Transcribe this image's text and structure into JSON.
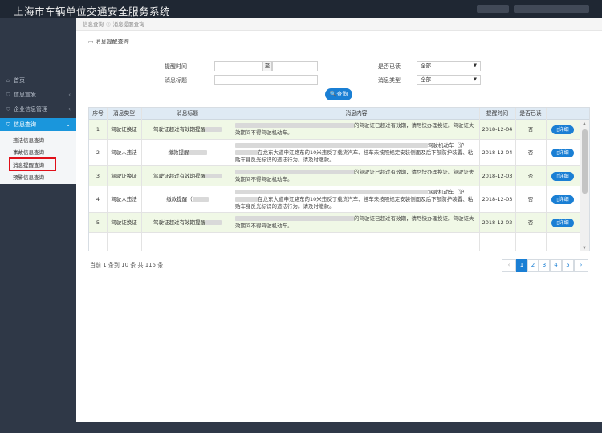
{
  "app": {
    "title": "上海市车辆单位交通安全服务系统"
  },
  "sidebar": {
    "items": [
      {
        "label": "首页",
        "icon": "home-icon"
      },
      {
        "label": "信息宣发",
        "icon": "shield-icon"
      },
      {
        "label": "企业信息管理",
        "icon": "shield-icon"
      },
      {
        "label": "信息查询",
        "icon": "shield-icon"
      }
    ],
    "sub_items": [
      "违法信息查询",
      "事故信息查询",
      "消息提醒查询",
      "预警信息查询"
    ]
  },
  "breadcrumb": [
    "信息查询",
    "消息提醒查询"
  ],
  "page": {
    "title": "消息提醒查询"
  },
  "filters": {
    "remind_time_label": "提醒时间",
    "to_label": "至",
    "title_label": "消息标题",
    "read_label": "是否已读",
    "read_value": "全部",
    "type_label": "消息类型",
    "type_value": "全部",
    "query_label": "查询"
  },
  "table": {
    "headers": [
      "序号",
      "消息类型",
      "消息标题",
      "消息内容",
      "提醒时间",
      "是否已读",
      ""
    ],
    "detail_label": "详细",
    "rows": [
      {
        "no": "1",
        "type": "驾驶证换证",
        "title": "驾驶证超过有效期提醒",
        "content": "的驾驶证已超过有效期，请尽快办理换证。驾驶证失效期间不得驾驶机动车。",
        "time": "2018-12-04",
        "read": "否"
      },
      {
        "no": "2",
        "type": "驾驶人违法",
        "title": "缴款提醒",
        "content_a": "驾驶机动车（沪",
        "content_b": "在龙东大道申江路东的10米违反了载货汽车、挂车未按照规定安装侧面及后下部防护装置、粘贴车身反光标识的违法行为。请及时缴款。",
        "time": "2018-12-04",
        "read": "否"
      },
      {
        "no": "3",
        "type": "驾驶证换证",
        "title": "驾驶证超过有效期提醒",
        "content": "的驾驶证已超过有效期，请尽快办理换证。驾驶证失效期间不得驾驶机动车。",
        "time": "2018-12-03",
        "read": "否"
      },
      {
        "no": "4",
        "type": "驾驶人违法",
        "title": "缴款提醒（",
        "content_a": "驾驶机动车（沪",
        "content_b": "在龙东大道申江路东的10米违反了载货汽车、挂车未按照规定安装侧面及后下部防护装置、粘贴车身反光标识的违法行为。请及时缴款。",
        "time": "2018-12-03",
        "read": "否"
      },
      {
        "no": "5",
        "type": "驾驶证换证",
        "title": "驾驶证超过有效期提醒",
        "content": "的驾驶证已超过有效期，请尽快办理换证。驾驶证失效期间不得驾驶机动车。",
        "time": "2018-12-02",
        "read": "否"
      }
    ]
  },
  "pagination": {
    "info": "当前 1 条到 10 条 共 115 条",
    "prev": "‹",
    "next": "›",
    "pages": [
      "1",
      "2",
      "3",
      "4",
      "5"
    ]
  }
}
